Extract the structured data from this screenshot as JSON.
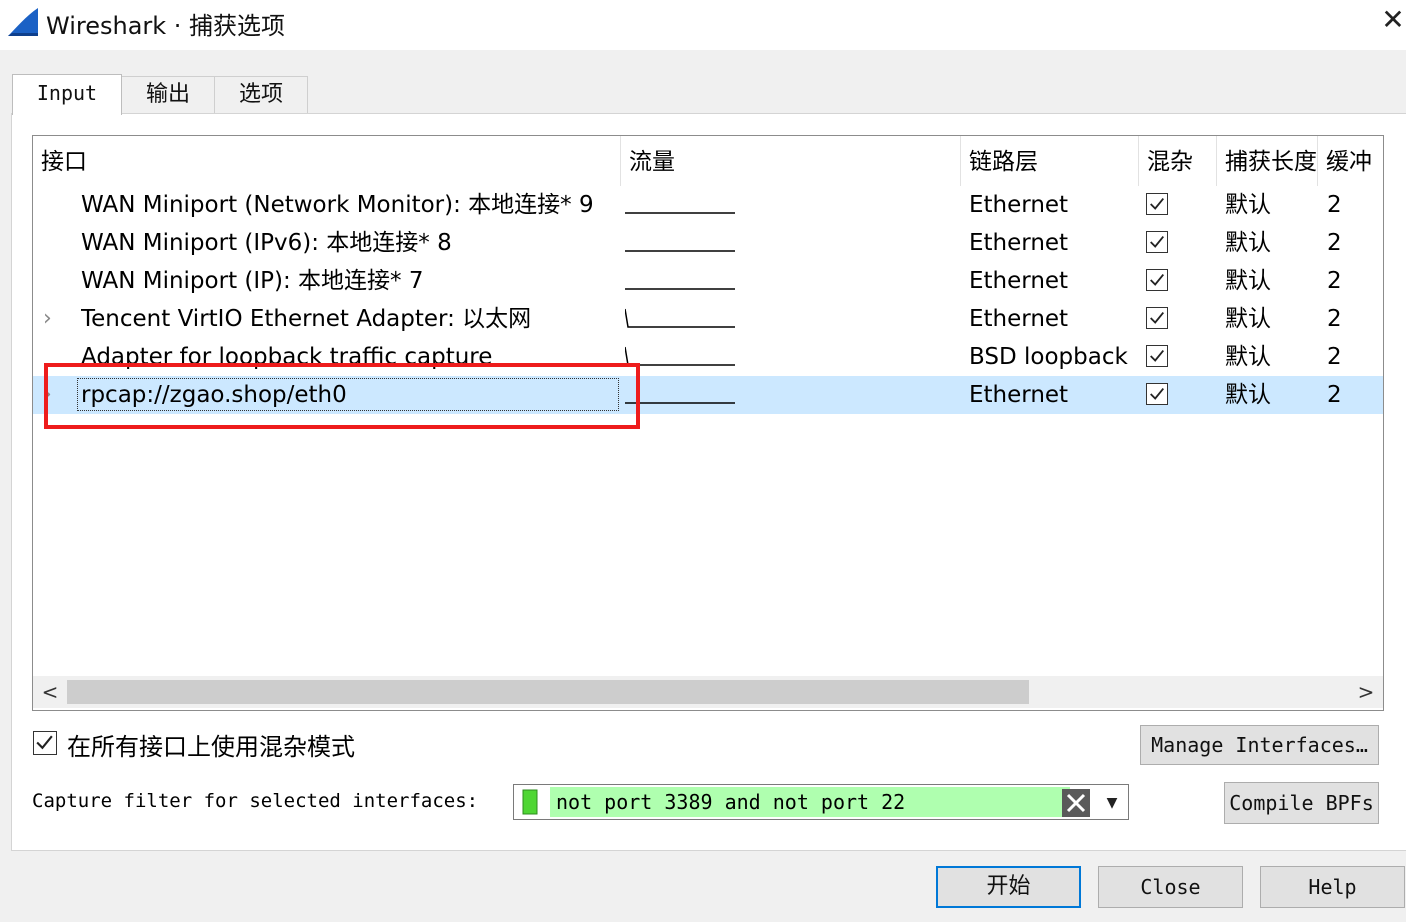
{
  "window": {
    "title": "Wireshark · 捕获选项",
    "close_glyph": "✕"
  },
  "tabs": [
    {
      "label": "Input",
      "active": true
    },
    {
      "label": "输出",
      "active": false
    },
    {
      "label": "选项",
      "active": false
    }
  ],
  "table": {
    "columns": [
      "接口",
      "流量",
      "链路层",
      "混杂",
      "捕获长度",
      "缓冲"
    ],
    "rows": [
      {
        "interface": "WAN Miniport (Network Monitor): 本地连接* 9",
        "link": "Ethernet",
        "promisc": true,
        "snaplen": "默认",
        "buffer": "2",
        "expandable": false,
        "selected": false
      },
      {
        "interface": "WAN Miniport (IPv6): 本地连接* 8",
        "link": "Ethernet",
        "promisc": true,
        "snaplen": "默认",
        "buffer": "2",
        "expandable": false,
        "selected": false
      },
      {
        "interface": "WAN Miniport (IP): 本地连接* 7",
        "link": "Ethernet",
        "promisc": true,
        "snaplen": "默认",
        "buffer": "2",
        "expandable": false,
        "selected": false
      },
      {
        "interface": "Tencent VirtIO Ethernet Adapter: 以太网",
        "link": "Ethernet",
        "promisc": true,
        "snaplen": "默认",
        "buffer": "2",
        "expandable": true,
        "selected": false
      },
      {
        "interface": "Adapter for loopback traffic capture",
        "link": "BSD loopback",
        "promisc": true,
        "snaplen": "默认",
        "buffer": "2",
        "expandable": false,
        "selected": false
      },
      {
        "interface": "rpcap://zgao.shop/eth0",
        "link": "Ethernet",
        "promisc": true,
        "snaplen": "默认",
        "buffer": "2",
        "expandable": true,
        "selected": true
      }
    ]
  },
  "promisc_all": {
    "label": "在所有接口上使用混杂模式",
    "checked": true
  },
  "capture_filter": {
    "label": "Capture filter for selected interfaces:",
    "value": "not port 3389 and not port 22"
  },
  "buttons": {
    "manage": "Manage Interfaces…",
    "compile": "Compile BPFs",
    "start": "开始",
    "close": "Close",
    "help": "Help"
  },
  "colors": {
    "selection": "#cce8ff",
    "filter_valid": "#afffaf",
    "highlight": "#ee1c1c",
    "accent": "#0078d7"
  }
}
